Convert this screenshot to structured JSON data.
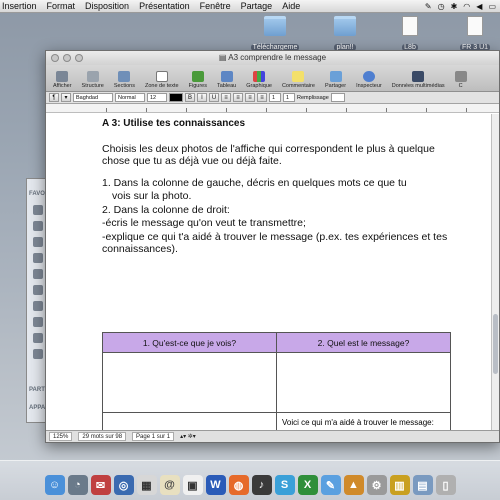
{
  "menubar": {
    "items": [
      "Insertion",
      "Format",
      "Disposition",
      "Présentation",
      "Fenêtre",
      "Partage",
      "Aide"
    ]
  },
  "desktop": {
    "icons": [
      {
        "label": "Téléchargeme"
      },
      {
        "label": "plan!!"
      },
      {
        "label": "L8b"
      },
      {
        "label": "FR 3 U1"
      }
    ]
  },
  "finder": {
    "labels": [
      "FAVO",
      "PART",
      "APPA"
    ]
  },
  "window": {
    "title": "A3 comprendre le message"
  },
  "toolbar": {
    "items": [
      "Afficher",
      "Structure",
      "Sections",
      "Zone de texte",
      "Figures",
      "Tableau",
      "Graphique",
      "Commentaire",
      "Partager",
      "Inspecteur",
      "Données multimédias",
      "C"
    ]
  },
  "formatbar": {
    "font": "Baghdad",
    "style": "Normal",
    "size": "12",
    "spacing": "1",
    "columns": "1",
    "fill_label": "Remplissage"
  },
  "document": {
    "heading": "A 3: Utilise tes connaissances",
    "intro": "Choisis les deux photos de l'affiche qui correspondent le plus à quelque chose que tu as déjà vue ou déjà faite.",
    "instruction1": "1. Dans la colonne de gauche, décris en quelques mots ce que tu",
    "instruction1b": "vois sur la photo.",
    "instruction2": "2. Dans la colonne de droit:",
    "instruction2a": "-écris le message qu'on veut te transmettre;",
    "instruction2b": "-explique ce qui t'a aidé à trouver le message (p.ex. tes expériences et tes connaissances).",
    "table": {
      "col1": "1. Qu'est-ce que je vois?",
      "col2": "2. Quel est le message?",
      "help_text": "Voici ce qui m'a aidé à trouver le message:"
    }
  },
  "statusbar": {
    "zoom": "125%",
    "words": "29 mots sur 98",
    "page": "Page 1 sur 1"
  },
  "colors": {
    "table_header": "#c8a8e8"
  }
}
